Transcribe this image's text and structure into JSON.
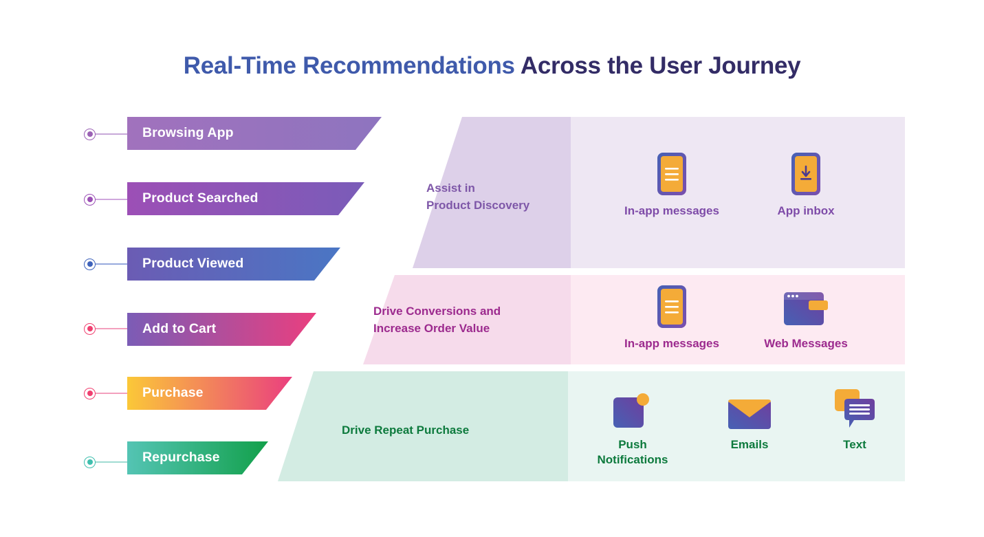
{
  "title": {
    "part1": "Real-Time Recommendations",
    "part2": " Across the User Journey",
    "color1": "#3f5aab",
    "color2": "#332c66"
  },
  "stages": [
    {
      "label": "Browsing App",
      "marker_color": "#9b62b5",
      "line_color": "#c7a8d8",
      "from": "#a172bd",
      "to": "#8e74bf"
    },
    {
      "label": "Product Searched",
      "marker_color": "#9b4fb5",
      "line_color": "#cfa7dd",
      "from": "#9c4fb6",
      "to": "#7a5cb8"
    },
    {
      "label": "Product Viewed",
      "marker_color": "#3f63bb",
      "line_color": "#97a9dd",
      "from": "#6b5cb4",
      "to": "#4a76c4"
    },
    {
      "label": "Add to Cart",
      "marker_color": "#ef4070",
      "line_color": "#f3a0bd",
      "from": "#7b5cb6",
      "to": "#ea3f7f"
    },
    {
      "label": "Purchase",
      "marker_color": "#ef4070",
      "line_color": "#f3a0bd",
      "from": "#fbc838",
      "to": "#ea3f7f"
    },
    {
      "label": "Repurchase",
      "marker_color": "#3fbfae",
      "line_color": "#9fdbd2",
      "from": "#54c4b4",
      "to": "#12a04a"
    }
  ],
  "outcomes": [
    {
      "goal": "Assist in\nProduct Discovery",
      "goal_color": "#7e57a8",
      "band_left": "#ddd0e9",
      "band_right": "#eee7f3",
      "channels": [
        {
          "name": "In-app messages",
          "icon": "phone-lines-icon"
        },
        {
          "name": "App inbox",
          "icon": "phone-download-icon"
        }
      ],
      "caption_color": "#7e4ba8"
    },
    {
      "goal": "Drive Conversions and\nIncrease Order Value",
      "goal_color": "#9c2a8e",
      "band_left": "#f6dbeb",
      "band_right": "#fdeaf2",
      "channels": [
        {
          "name": "In-app messages",
          "icon": "phone-lines-icon"
        },
        {
          "name": "Web Messages",
          "icon": "browser-window-icon"
        }
      ],
      "caption_color": "#9c2a8e"
    },
    {
      "goal": "Drive Repeat Purchase",
      "goal_color": "#0d7a3d",
      "band_left": "#d3ece3",
      "band_right": "#e9f5f2",
      "channels": [
        {
          "name": "Push\nNotifications",
          "icon": "push-square-icon"
        },
        {
          "name": "Emails",
          "icon": "envelope-icon"
        },
        {
          "name": "Text",
          "icon": "chat-bubbles-icon"
        }
      ],
      "caption_color": "#0d7a3d"
    }
  ],
  "palette": {
    "icon_orange": "#f4ab38",
    "icon_purple": "#6d4aa8",
    "icon_blue": "#4661b4"
  }
}
